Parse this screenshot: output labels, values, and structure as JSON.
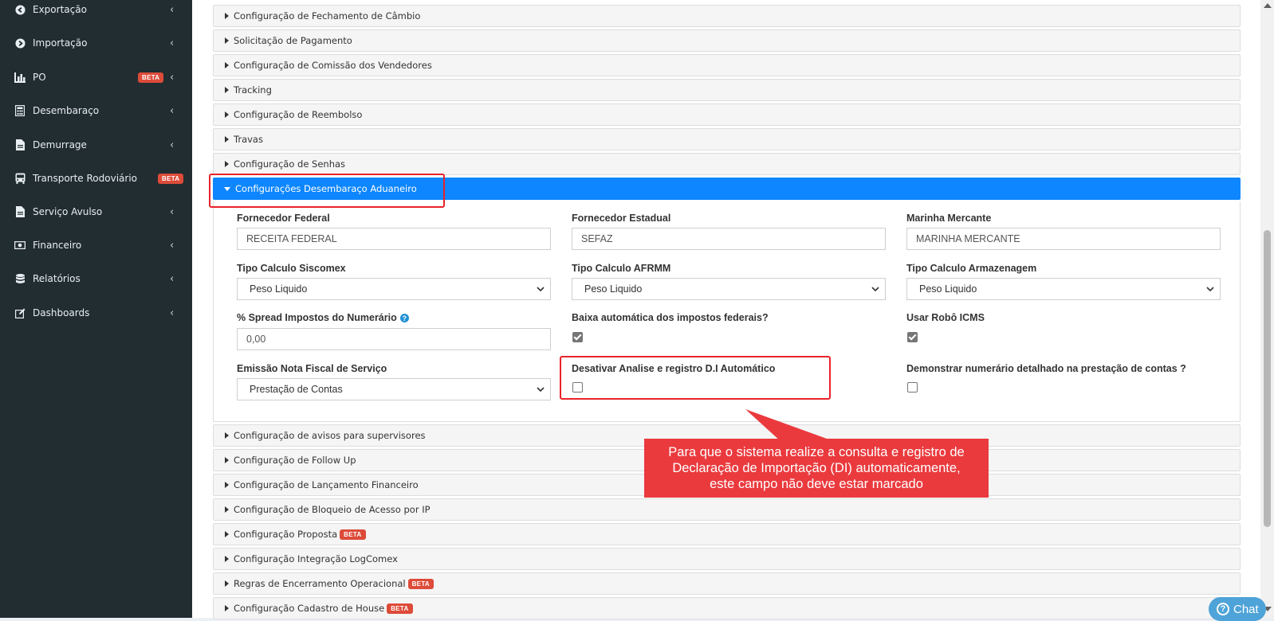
{
  "sidebar": {
    "items": [
      {
        "label": "Exportação",
        "icon": "arrow-circle-left-icon",
        "chevron": "‹"
      },
      {
        "label": "Importação",
        "icon": "arrow-circle-right-icon",
        "chevron": "‹"
      },
      {
        "label": "PO",
        "icon": "bar-chart-icon",
        "badge": "BETA",
        "chevron": "‹"
      },
      {
        "label": "Desembaraço",
        "icon": "calculator-icon",
        "chevron": "‹"
      },
      {
        "label": "Demurrage",
        "icon": "file-icon",
        "chevron": "‹"
      },
      {
        "label": "Transporte Rodoviário",
        "icon": "bus-icon",
        "badge": "BETA"
      },
      {
        "label": "Serviço Avulso",
        "icon": "file-icon",
        "chevron": "‹"
      },
      {
        "label": "Financeiro",
        "icon": "money-icon",
        "chevron": "‹"
      },
      {
        "label": "Relatórios",
        "icon": "database-icon",
        "chevron": "‹"
      },
      {
        "label": "Dashboards",
        "icon": "edit-icon",
        "chevron": "‹"
      }
    ]
  },
  "accordion_top": [
    {
      "label": "Configuração de Fechamento de Câmbio"
    },
    {
      "label": "Solicitação de Pagamento"
    },
    {
      "label": "Configuração de Comissão dos Vendedores"
    },
    {
      "label": "Tracking"
    },
    {
      "label": "Configuração de Reembolso"
    },
    {
      "label": "Travas"
    },
    {
      "label": "Configuração de Senhas"
    }
  ],
  "active_section": {
    "label": "Configurações Desembaraço Aduaneiro"
  },
  "form": {
    "fornecedor_federal": {
      "label": "Fornecedor Federal",
      "value": "RECEITA FEDERAL"
    },
    "fornecedor_estadual": {
      "label": "Fornecedor Estadual",
      "value": "SEFAZ"
    },
    "marinha_mercante": {
      "label": "Marinha Mercante",
      "value": "MARINHA MERCANTE"
    },
    "tipo_calculo_siscomex": {
      "label": "Tipo Calculo Siscomex",
      "value": "Peso Liquido"
    },
    "tipo_calculo_afrmm": {
      "label": "Tipo Calculo AFRMM",
      "value": "Peso Liquido"
    },
    "tipo_calculo_armazenagem": {
      "label": "Tipo Calculo Armazenagem",
      "value": "Peso Liquido"
    },
    "spread_impostos": {
      "label": "% Spread Impostos do Numerário",
      "value": "0,00",
      "help": "?"
    },
    "baixa_automatica": {
      "label": "Baixa automática dos impostos federais?",
      "checked": true
    },
    "usar_robo_icms": {
      "label": "Usar Robô ICMS",
      "checked": true
    },
    "emissao_nota_fiscal": {
      "label": "Emissão Nota Fiscal de Serviço",
      "value": "Prestação de Contas"
    },
    "desativar_analise": {
      "label": "Desativar Analise e registro D.I Automático",
      "checked": false
    },
    "demonstrar_numerario": {
      "label": "Demonstrar numerário detalhado na prestação de contas ?",
      "checked": false
    }
  },
  "accordion_bottom": [
    {
      "label": "Configuração de avisos para supervisores"
    },
    {
      "label": "Configuração de Follow Up"
    },
    {
      "label": "Configuração de Lançamento Financeiro"
    },
    {
      "label": "Configuração de Bloqueio de Acesso por IP"
    },
    {
      "label": "Configuração Proposta",
      "badge": "BETA"
    },
    {
      "label": "Configuração Integração LogComex"
    },
    {
      "label": "Regras de Encerramento Operacional",
      "badge": "BETA"
    },
    {
      "label": "Configuração Cadastro de House",
      "badge": "BETA"
    }
  ],
  "callout": {
    "line1": "Para que o sistema realize a consulta e registro de",
    "line2": "Declaração de Importação (DI) automaticamente,",
    "line3": "este campo não deve estar marcado"
  },
  "chat": {
    "label": "Chat",
    "icon": "?"
  },
  "colors": {
    "sidebar": "#222d32",
    "active": "#0d86ff",
    "annotation": "#e8232a",
    "beta": "#dd4b39"
  }
}
